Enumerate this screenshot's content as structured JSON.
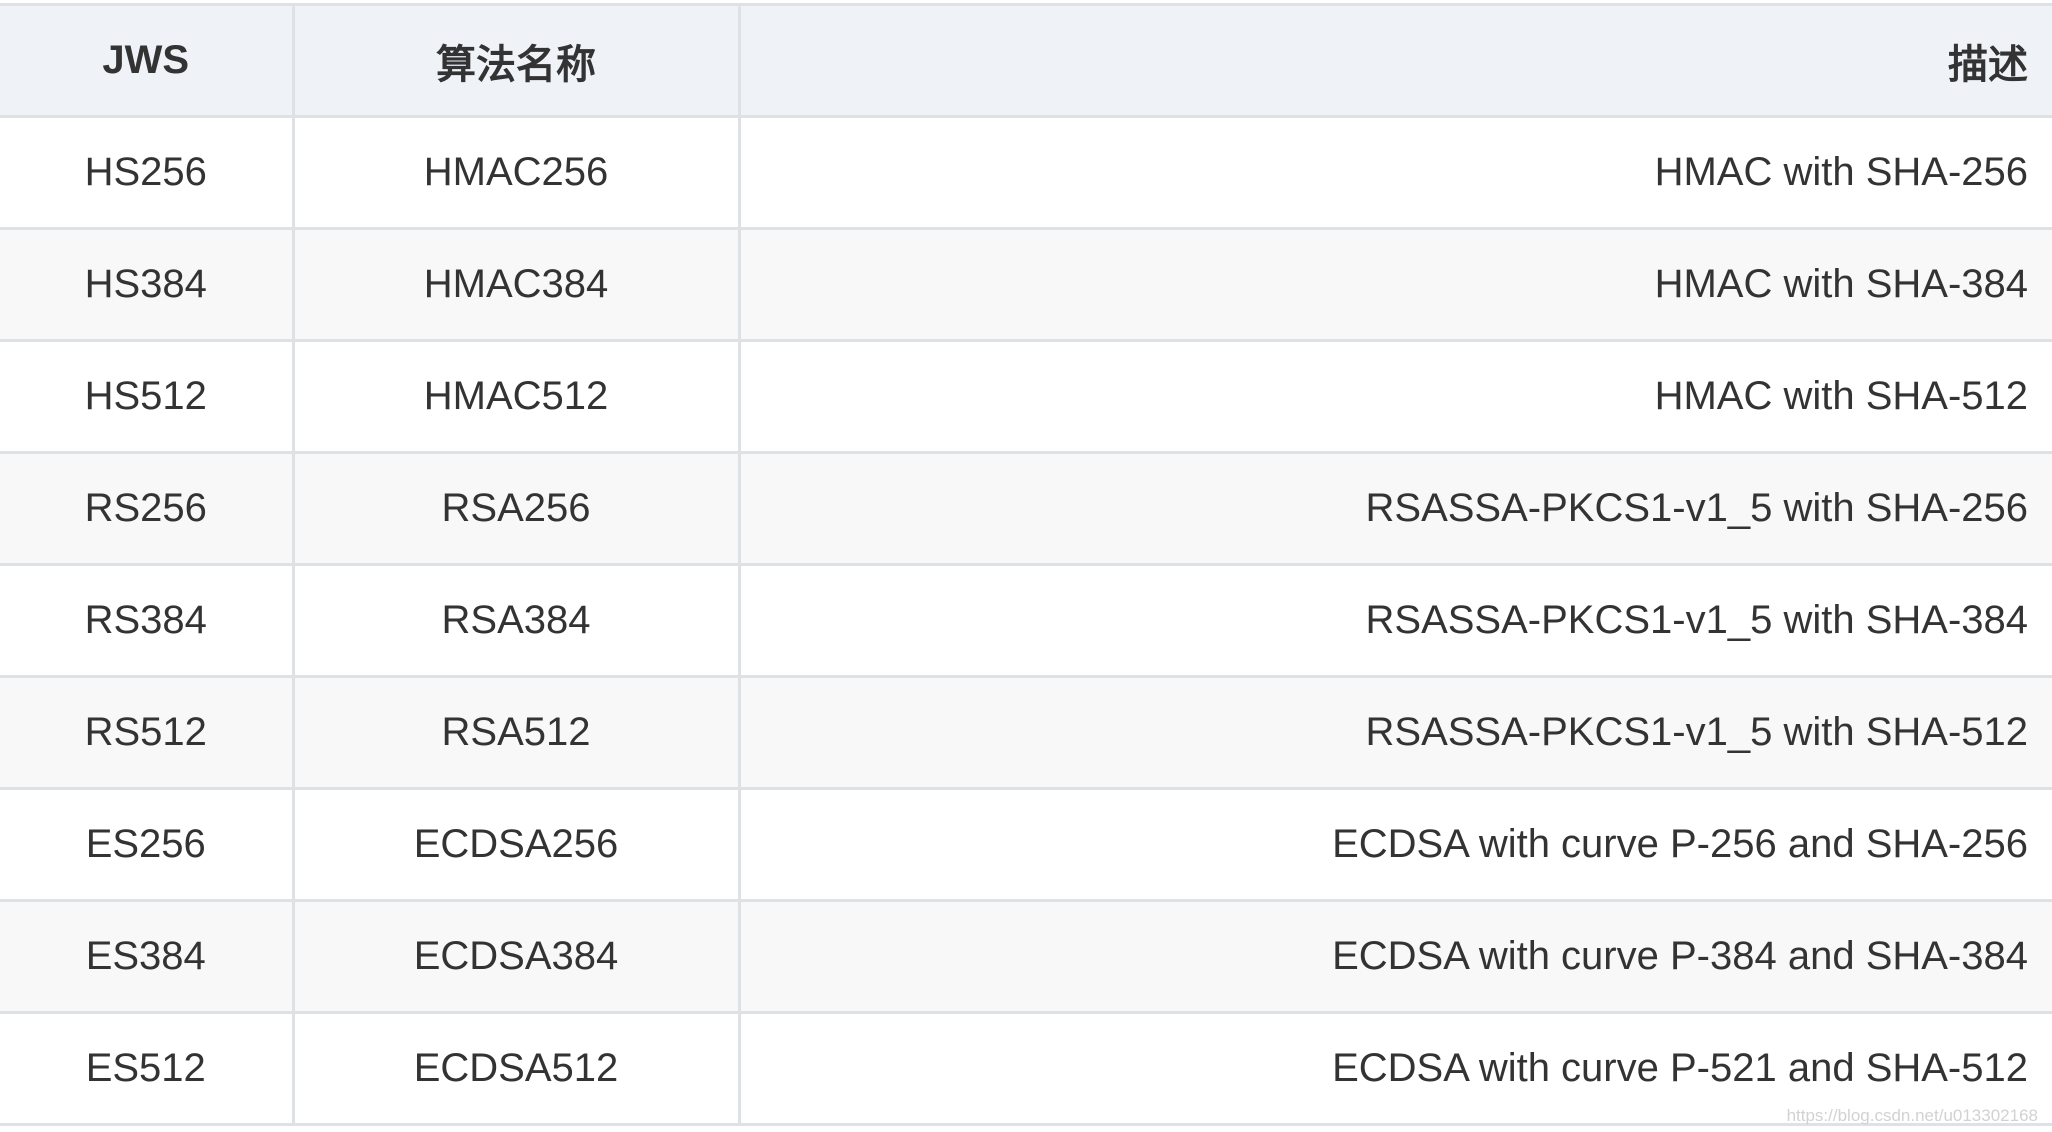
{
  "table": {
    "headers": [
      "JWS",
      "算法名称",
      "描述"
    ],
    "rows": [
      [
        "HS256",
        "HMAC256",
        "HMAC with SHA-256"
      ],
      [
        "HS384",
        "HMAC384",
        "HMAC with SHA-384"
      ],
      [
        "HS512",
        "HMAC512",
        "HMAC with SHA-512"
      ],
      [
        "RS256",
        "RSA256",
        "RSASSA-PKCS1-v1_5 with SHA-256"
      ],
      [
        "RS384",
        "RSA384",
        "RSASSA-PKCS1-v1_5 with SHA-384"
      ],
      [
        "RS512",
        "RSA512",
        "RSASSA-PKCS1-v1_5 with SHA-512"
      ],
      [
        "ES256",
        "ECDSA256",
        "ECDSA with curve P-256 and SHA-256"
      ],
      [
        "ES384",
        "ECDSA384",
        "ECDSA with curve P-384 and SHA-384"
      ],
      [
        "ES512",
        "ECDSA512",
        "ECDSA with curve P-521 and SHA-512"
      ]
    ]
  },
  "watermark": "https://blog.csdn.net/u013302168",
  "colors": {
    "header_bg": "#eff3f7",
    "stripe_bg": "#f8f8f8",
    "border": "#dfe2e5",
    "text": "#333333"
  }
}
